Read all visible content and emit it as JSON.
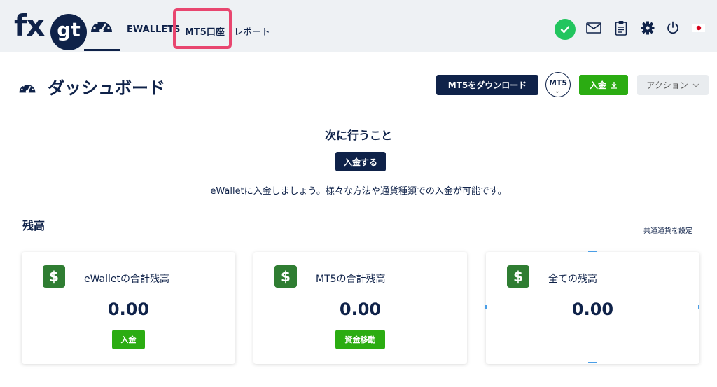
{
  "brand": {
    "logo_fx": "fx",
    "logo_gt": "gt"
  },
  "nav": {
    "ewallets": "EWALLETS",
    "mt5_accounts": "MT5口座",
    "report": "レポート"
  },
  "header_icons": [
    "check-circle-icon",
    "mail-icon",
    "clipboard-icon",
    "gear-icon",
    "power-icon",
    "japan-flag-icon"
  ],
  "page": {
    "title": "ダッシュボード",
    "download_button": "MT5をダウンロード",
    "mt5_badge": "MT5",
    "deposit_button": "入金",
    "action_button": "アクション"
  },
  "next_steps": {
    "title": "次に行うこと",
    "button": "入金する",
    "description": "eWalletに入金しましょう。様々な方法や通貨種類での入金が可能です。"
  },
  "balance": {
    "title": "残高",
    "currency_link": "共通通貨を設定",
    "cards": [
      {
        "label": "eWalletの合計残高",
        "value": "0.00",
        "button": "入金"
      },
      {
        "label": "MT5の合計残高",
        "value": "0.00",
        "button": "資金移動"
      },
      {
        "label": "全ての残高",
        "value": "0.00"
      }
    ]
  },
  "colors": {
    "navy": "#0f2249",
    "green": "#2bac12",
    "highlight": "#e8466f",
    "status_green": "#22c55e"
  }
}
